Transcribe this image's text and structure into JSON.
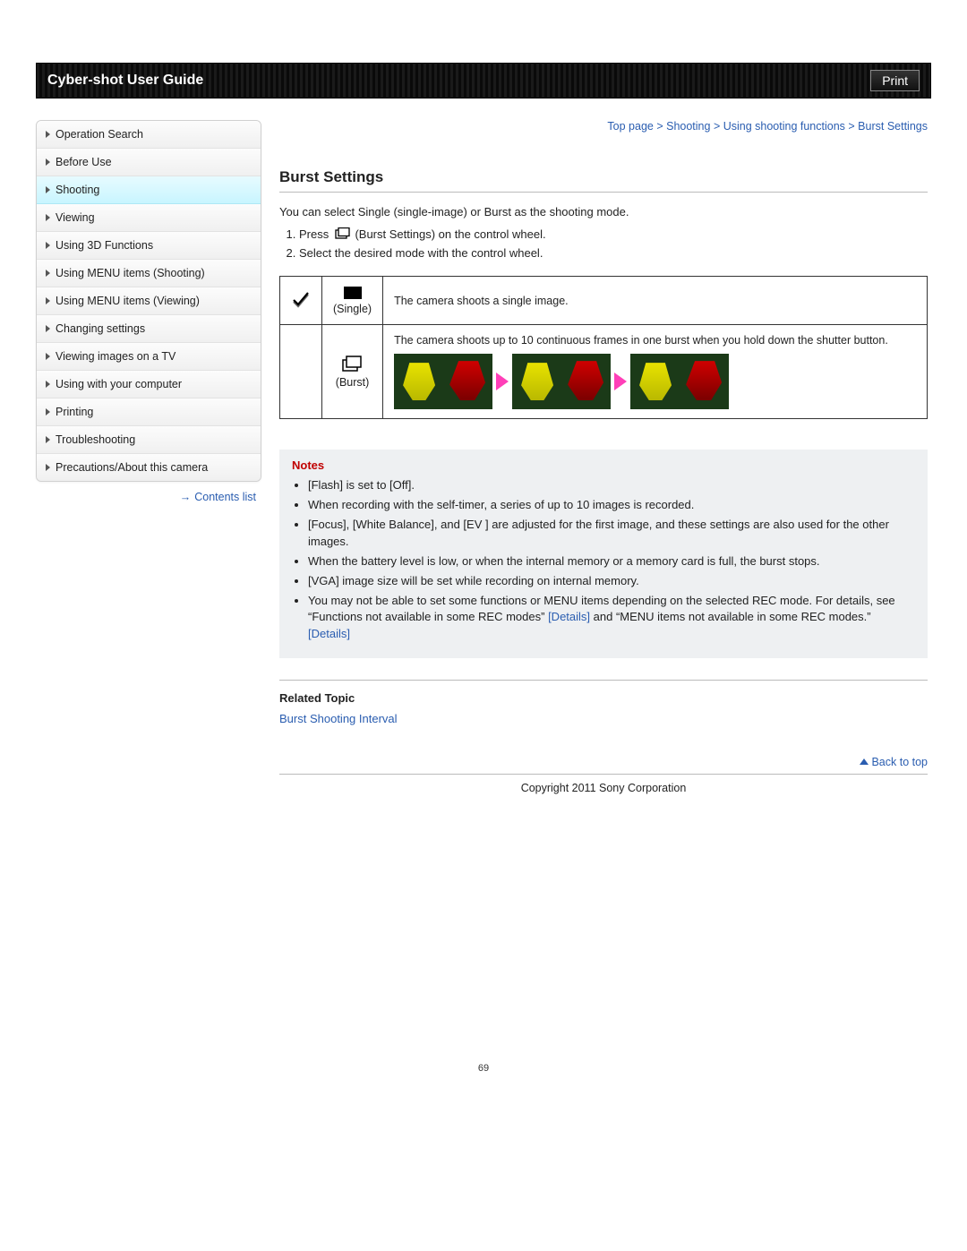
{
  "header": {
    "title": "Cyber-shot User Guide",
    "print": "Print"
  },
  "breadcrumb": {
    "top": "Top page",
    "l1": "Shooting",
    "l2": "Using shooting functions",
    "l3": "Burst Settings",
    "sep": " > "
  },
  "sidebar": {
    "items": [
      {
        "label": "Operation Search",
        "active": false
      },
      {
        "label": "Before Use",
        "active": false
      },
      {
        "label": "Shooting",
        "active": true
      },
      {
        "label": "Viewing",
        "active": false
      },
      {
        "label": "Using 3D Functions",
        "active": false
      },
      {
        "label": "Using MENU items (Shooting)",
        "active": false
      },
      {
        "label": "Using MENU items (Viewing)",
        "active": false
      },
      {
        "label": "Changing settings",
        "active": false
      },
      {
        "label": "Viewing images on a TV",
        "active": false
      },
      {
        "label": "Using with your computer",
        "active": false
      },
      {
        "label": "Printing",
        "active": false
      },
      {
        "label": "Troubleshooting",
        "active": false
      },
      {
        "label": "Precautions/About this camera",
        "active": false
      }
    ],
    "contents_list": "Contents list"
  },
  "main": {
    "title": "Burst Settings",
    "intro": "You can select Single (single-image) or Burst as the shooting mode.",
    "step1_a": "Press ",
    "step1_b": " (Burst Settings) on the control wheel.",
    "step2": "Select the desired mode with the control wheel.",
    "table": {
      "single_label": "(Single)",
      "single_desc": "The camera shoots a single image.",
      "burst_label": "(Burst)",
      "burst_desc": "The camera shoots up to 10 continuous frames in one burst when you hold down the shutter button."
    },
    "notes_title": "Notes",
    "notes": [
      "[Flash] is set to [Off].",
      "When recording with the self-timer, a series of up to 10 images is recorded.",
      "[Focus], [White Balance], and [EV ] are adjusted for the first image, and these settings are also used for the other images.",
      "When the battery level is low, or when the internal memory or a memory card is full, the burst stops.",
      "[VGA] image size will be set while recording on internal memory."
    ],
    "note6_a": "You may not be able to set some functions or MENU items depending on the selected REC mode. For details, see “Functions not available in some REC modes” ",
    "note6_b": " and “MENU items not available in some REC modes.” ",
    "details_link": "[Details]",
    "related_title": "Related Topic",
    "related_link": "Burst Shooting Interval",
    "back_top": "Back to top",
    "copyright": "Copyright 2011 Sony Corporation",
    "page_num": "69"
  }
}
